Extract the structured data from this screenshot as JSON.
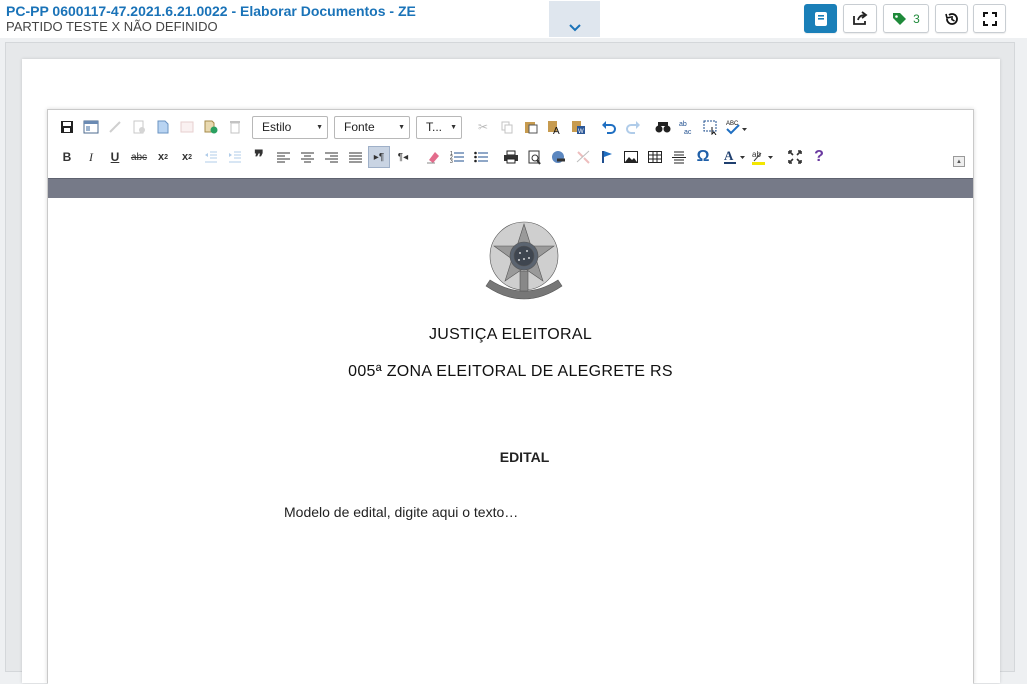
{
  "header": {
    "title": "PC-PP 0600117-47.2021.6.21.0022 - Elaborar Documentos - ZE",
    "subtitle": "PARTIDO TESTE X NÃO DEFINIDO",
    "tag_count": "3"
  },
  "editor": {
    "style_combo": "Estilo",
    "font_combo": "Fonte",
    "size_combo": "T..."
  },
  "document": {
    "line1": "JUSTIÇA ELEITORAL",
    "line2": "005ª ZONA ELEITORAL DE ALEGRETE RS",
    "heading": "EDITAL",
    "body": "Modelo de edital, digite aqui o texto…"
  },
  "colors": {
    "accent": "#1a7fb8",
    "title": "#1a73b8",
    "tag": "#1f8a3a",
    "band": "#767a88"
  }
}
